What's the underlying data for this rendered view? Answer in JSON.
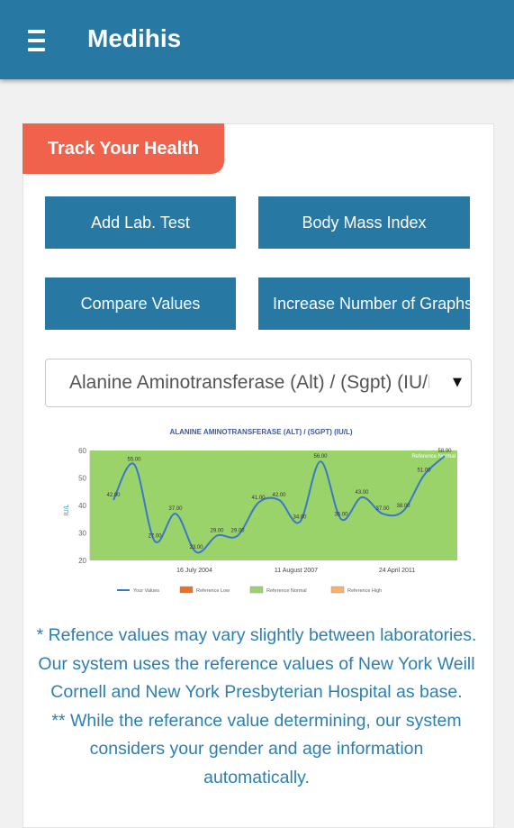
{
  "app": {
    "title": "Medihis"
  },
  "section": {
    "title": "Track Your Health"
  },
  "buttons": {
    "add_lab_test": "Add Lab. Test",
    "body_mass_index": "Body Mass Index",
    "compare_values": "Compare Values",
    "increase_graphs": "Increase Number of Graphs"
  },
  "test_select": {
    "selected": "Alanine Aminotransferase (Alt) / (Sgpt) (IU/L)"
  },
  "chart_data": {
    "type": "line",
    "title": "ALANINE AMINOTRANSFERASE (ALT) / (SGPT) (IU/L)",
    "ylabel": "IU/L",
    "ylim": [
      20,
      60
    ],
    "yticks": [
      20,
      30,
      40,
      50,
      60
    ],
    "x_tick_labels": [
      "16 July 2004",
      "11 August 2007",
      "24 April 2011"
    ],
    "grid": false,
    "band_label": "Reference Normal",
    "reference_normal": [
      20,
      60
    ],
    "series": [
      {
        "name": "Your Values",
        "values": [
          42.0,
          55.0,
          27.0,
          37.0,
          23.0,
          29.0,
          29.0,
          41.0,
          42.0,
          34.0,
          56.0,
          35.0,
          43.0,
          37.0,
          38.0,
          51.0,
          58.0
        ]
      }
    ],
    "legend": [
      "Your Values",
      "Reference Low",
      "Reference Normal",
      "Reference High"
    ],
    "legend_position": "bottom",
    "colors": {
      "line": "#3a78c8",
      "reference_low": "#e8701e",
      "reference_normal": "#9bd36b",
      "reference_high": "#f6b26b"
    }
  },
  "notes": [
    "* Refence values may vary slightly between laboratories. Our system uses the reference values of New York Weill Cornell and New York Presbyterian Hospital as base.",
    "** While the referance value determining, our system considers your gender and age information automatically."
  ]
}
